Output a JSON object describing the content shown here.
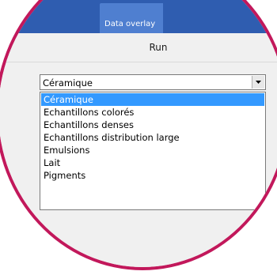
{
  "tabs": [
    {
      "label": "Data overlay"
    }
  ],
  "toolbar": {
    "run_label": "Run"
  },
  "combo": {
    "value": "Céramique"
  },
  "options": [
    {
      "label": "Céramique",
      "selected": true
    },
    {
      "label": "Echantillons colorés",
      "selected": false
    },
    {
      "label": "Echantillons denses",
      "selected": false
    },
    {
      "label": "Echantillons distribution large",
      "selected": false
    },
    {
      "label": "Emulsions",
      "selected": false
    },
    {
      "label": "Lait",
      "selected": false
    },
    {
      "label": "Pigments",
      "selected": false
    }
  ],
  "colors": {
    "frame": "#c2185b",
    "tabbar": "#2f5db0",
    "tab": "#4f7fd0",
    "selection": "#3399ff"
  },
  "icons": {
    "combo_arrow": "chevron-down-icon"
  }
}
